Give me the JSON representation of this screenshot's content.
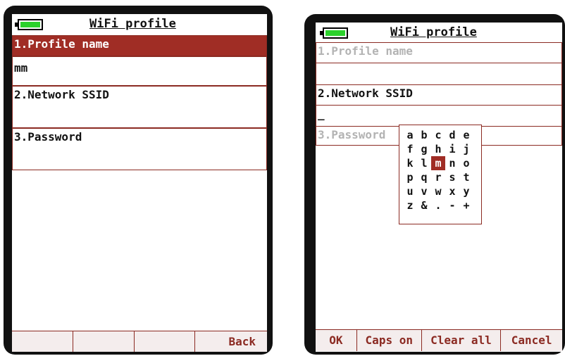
{
  "colors": {
    "accent": "#a02d25",
    "battery": "#2bd12b",
    "frame": "#111111"
  },
  "left": {
    "title": "WiFi profile",
    "battery_icon": "battery-icon",
    "fields": [
      {
        "label": "1.Profile name",
        "value": "mm"
      },
      {
        "label": "2.Network SSID",
        "value": ""
      },
      {
        "label": "3.Password",
        "value": ""
      }
    ],
    "softkeys": [
      "",
      "",
      "",
      "Back"
    ]
  },
  "right": {
    "title": "WiFi profile",
    "battery_icon": "battery-icon",
    "fields": [
      {
        "label": "1.Profile name",
        "value": ""
      },
      {
        "label": "2.Network SSID",
        "value": "_"
      },
      {
        "label": "3.Password",
        "value": ""
      }
    ],
    "keyboard": {
      "rows": [
        [
          "a",
          "b",
          "c",
          "d",
          "e"
        ],
        [
          "f",
          "g",
          "h",
          "i",
          "j"
        ],
        [
          "k",
          "l",
          "m",
          "n",
          "o"
        ],
        [
          "p",
          "q",
          "r",
          "s",
          "t"
        ],
        [
          "u",
          "v",
          "w",
          "x",
          "y"
        ],
        [
          "z",
          "&",
          ".",
          "-",
          "+"
        ]
      ],
      "selected": "m"
    },
    "softkeys": [
      "OK",
      "Caps on",
      "Clear all",
      "Cancel"
    ]
  }
}
